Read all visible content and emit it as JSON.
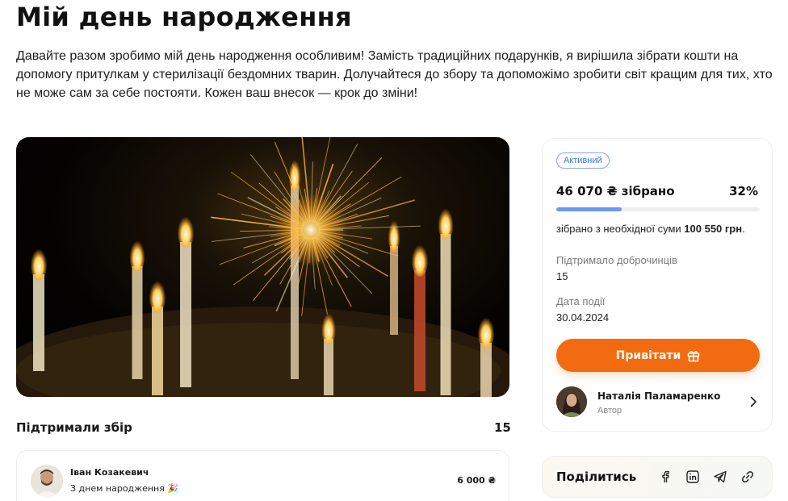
{
  "page": {
    "title": "Мій день народження",
    "description": "Давайте разом зробимо мій день народження особливим! Замість традиційних подарунків, я вирішила зібрати кошти на допомогу притулкам у стерилізації бездомних тварин. Долучайтеся до збору та допоможімо зробити світ кращим для тих, хто не може сам за себе постояти. Кожен ваш внесок — крок до зміни!"
  },
  "hero": {
    "icon": "birthday-candles-sparkler-photo"
  },
  "fundraiser": {
    "status": "Активний",
    "collected": "46 070 ₴ зібрано",
    "percent": "32%",
    "progress_fraction": 0.32,
    "goal_prefix": "зібрано з необхідної суми ",
    "goal_amount": "100 550 грн",
    "goal_suffix": ".",
    "donors_label": "Підтримало доброчинців",
    "donors_value": "15",
    "date_label": "Дата події",
    "date_value": "30.04.2024",
    "congrats_button": "Привітати",
    "congrats_icon": "gift-icon",
    "accent_color": "#f26b10",
    "progress_color": "#6c97ee"
  },
  "author": {
    "name": "Наталія Паламаренко",
    "role": "Автор"
  },
  "supporters": {
    "title": "Підтримали збір",
    "count": "15",
    "items": [
      {
        "name": "Іван Козакевич",
        "message": "З днем народження 🎉",
        "amount": "6 000 ₴"
      }
    ]
  },
  "share": {
    "label": "Поділитись",
    "icons": [
      "facebook-icon",
      "linkedin-icon",
      "telegram-icon",
      "link-icon"
    ]
  }
}
